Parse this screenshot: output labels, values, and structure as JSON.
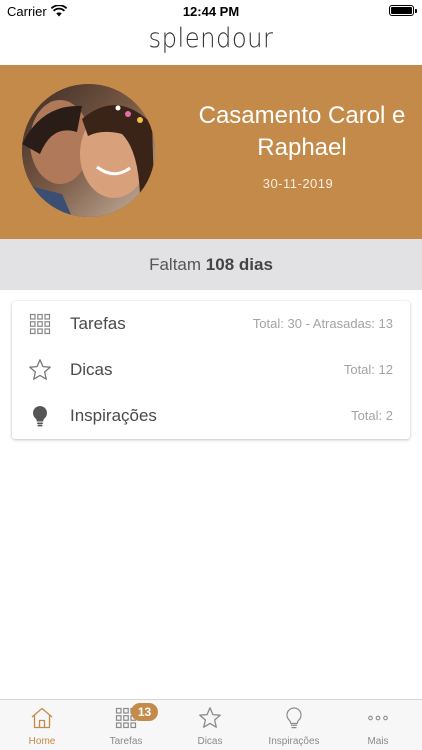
{
  "status_bar": {
    "carrier": "Carrier",
    "time": "12:44 PM"
  },
  "header": {
    "logo": "splendour"
  },
  "event": {
    "title": "Casamento Carol e Raphael",
    "date": "30-11-2019"
  },
  "countdown": {
    "prefix": "Faltam",
    "value": "108 dias"
  },
  "summary": [
    {
      "icon": "grid-icon",
      "label": "Tarefas",
      "meta": "Total: 30 - Atrasadas: 13"
    },
    {
      "icon": "star-icon",
      "label": "Dicas",
      "meta": "Total: 12"
    },
    {
      "icon": "lightbulb-icon",
      "label": "Inspirações",
      "meta": "Total: 2"
    }
  ],
  "tabs": [
    {
      "icon": "home-icon",
      "label": "Home",
      "active": true
    },
    {
      "icon": "grid-icon",
      "label": "Tarefas",
      "badge": "13"
    },
    {
      "icon": "star-icon",
      "label": "Dicas"
    },
    {
      "icon": "lightbulb-icon",
      "label": "Inspirações"
    },
    {
      "icon": "more-icon",
      "label": "Mais"
    }
  ],
  "colors": {
    "accent": "#c48a4a",
    "countdown_bg": "#e2e2e4",
    "tab_inactive": "#8a8a8a"
  }
}
